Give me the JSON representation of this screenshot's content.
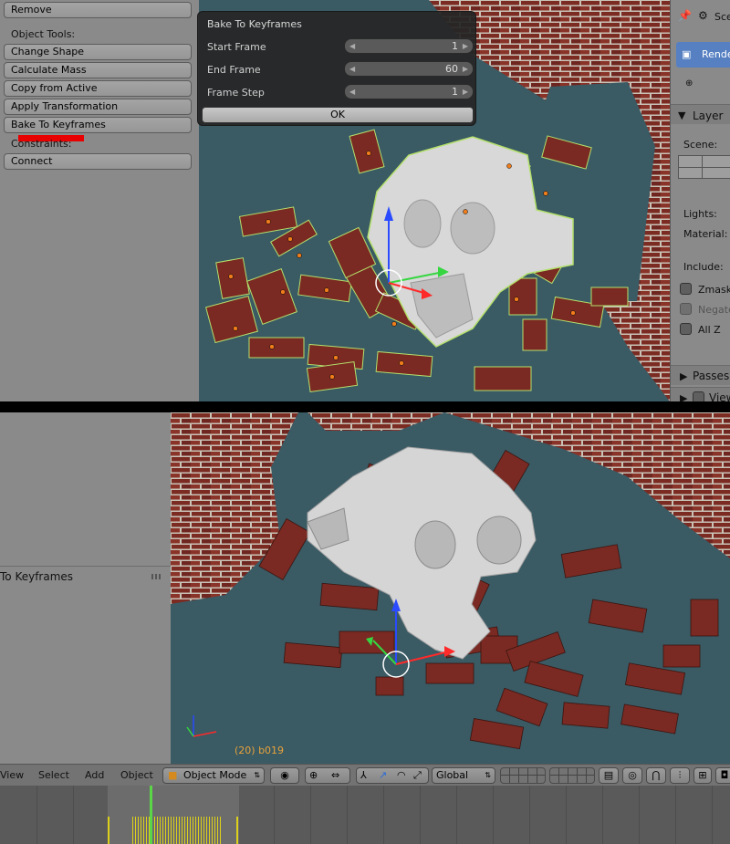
{
  "top": {
    "tool_shelf": {
      "remove_label": "Remove",
      "object_tools_label": "Object Tools:",
      "buttons": [
        "Change Shape",
        "Calculate Mass",
        "Copy from Active",
        "Apply Transformation",
        "Bake To Keyframes"
      ],
      "constraints_label": "Constraints:",
      "connect_label": "Connect"
    },
    "popup": {
      "title": "Bake To Keyframes",
      "fields": [
        {
          "label": "Start Frame",
          "value": "1"
        },
        {
          "label": "End Frame",
          "value": "60"
        },
        {
          "label": "Frame Step",
          "value": "1"
        }
      ],
      "ok_label": "OK"
    },
    "properties": {
      "scene_tab": "Sce",
      "render_layer_item": "Rende",
      "layer_header": "Layer",
      "scene_label": "Scene:",
      "lights_label": "Lights:",
      "material_label": "Material:",
      "include_label": "Include:",
      "zmask_label": "Zmask",
      "negate_label": "Negate",
      "allz_label": "All Z",
      "passes_label": "Passes",
      "views_label": "View"
    }
  },
  "bottom": {
    "last_operator": "To Keyframes",
    "object_info": "(20) b019",
    "header": {
      "menus": [
        "View",
        "Select",
        "Add",
        "Object"
      ],
      "mode": "Object Mode",
      "orientation": "Global"
    }
  },
  "colors": {
    "viewport_bg": "#3a5a64",
    "brick": "#7a2a22",
    "selection_outline": "#b4e06c",
    "annotation_red": "#e80000",
    "object_info_orange": "#e8a33a",
    "timeline_key_yellow": "#dcd01a",
    "current_frame_green": "#5bd646"
  }
}
